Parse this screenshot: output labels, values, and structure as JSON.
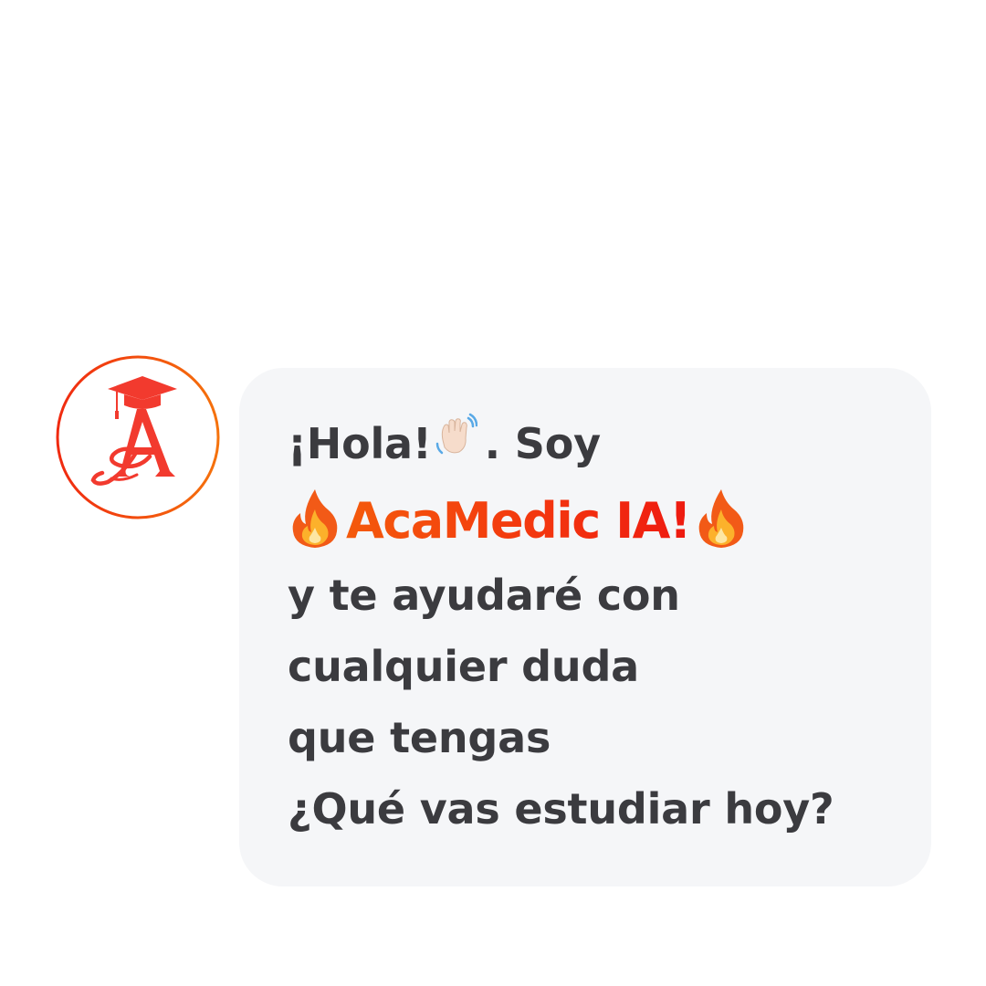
{
  "avatar": {
    "icon": "academic-logo-icon",
    "ring_colors": [
      "#f02a10",
      "#f5720c"
    ],
    "logo_color": "#f23a2e"
  },
  "message": {
    "greeting": "¡Hola!",
    "greeting_icon": "waving-hand-icon",
    "greeting_tail": ". Soy",
    "brand_name": "AcaMedic IA!",
    "brand_icon": "fire-icon",
    "line1": "y te ayudaré con",
    "line2": "cualquier duda",
    "line3": "que tengas",
    "question": "¿Qué vas estudiar hoy?"
  },
  "colors": {
    "bubble_background": "#f5f6f8",
    "text": "#3b3b3f",
    "brand_gradient": [
      "#f45a0c",
      "#ee1a10"
    ]
  }
}
